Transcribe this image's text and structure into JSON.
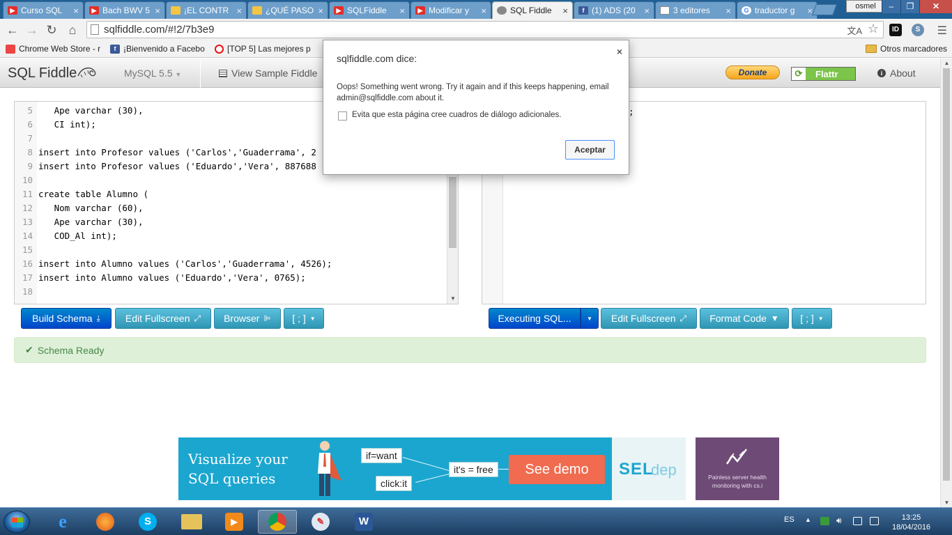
{
  "browser": {
    "tabs": [
      {
        "title": "Curso SQL",
        "icon": "youtube-icon"
      },
      {
        "title": "Bach BWV 5",
        "icon": "youtube-icon"
      },
      {
        "title": "¡EL CONTR",
        "icon": "page-icon"
      },
      {
        "title": "¿QUÉ PASO",
        "icon": "page-icon"
      },
      {
        "title": "SQLFiddle",
        "icon": "youtube-icon"
      },
      {
        "title": "Modificar y",
        "icon": "youtube-icon"
      },
      {
        "title": "SQL Fiddle",
        "icon": "gear-icon",
        "active": true
      },
      {
        "title": "(1) ADS (20",
        "icon": "facebook-icon"
      },
      {
        "title": "3 editores",
        "icon": "doc-icon"
      },
      {
        "title": "traductor g",
        "icon": "google-icon"
      }
    ],
    "tab_close": "×",
    "profile_name": "osmel",
    "window_controls": {
      "minimize": "‒",
      "restore": "❐",
      "close": "✕"
    },
    "url": "sqlfiddle.com/#!2/7b3e9",
    "bookmarks": [
      {
        "label": "Chrome Web Store - r",
        "icon": "webstore-icon"
      },
      {
        "label": "¡Bienvenido a Facebo",
        "icon": "facebook-icon"
      },
      {
        "label": "[TOP 5] Las mejores p",
        "icon": "opera-icon"
      }
    ],
    "other_bookmarks": "Otros marcadores"
  },
  "app": {
    "brand": "SQL Fiddle",
    "db_version": "MySQL 5.5",
    "view_sample": "View Sample Fiddle",
    "donate": "Donate",
    "flattr": "Flattr",
    "about": "About"
  },
  "schema_editor": {
    "lines": [
      {
        "n": "5",
        "text": "   Ape varchar (30),"
      },
      {
        "n": "6",
        "text": "   CI int);"
      },
      {
        "n": "7",
        "text": ""
      },
      {
        "n": "8",
        "text": "insert into Profesor values ('Carlos','Guaderrama', 2"
      },
      {
        "n": "9",
        "text": "insert into Profesor values ('Eduardo','Vera', 887688"
      },
      {
        "n": "10",
        "text": ""
      },
      {
        "n": "11",
        "text": "create table Alumno ("
      },
      {
        "n": "12",
        "text": "   Nom varchar (60),"
      },
      {
        "n": "13",
        "text": "   Ape varchar (30),"
      },
      {
        "n": "14",
        "text": "   COD_Al int);"
      },
      {
        "n": "15",
        "text": ""
      },
      {
        "n": "16",
        "text": "insert into Alumno values ('Carlos','Guaderrama', 4526);"
      },
      {
        "n": "17",
        "text": "insert into Alumno values ('Eduardo','Vera', 0765);"
      },
      {
        "n": "18",
        "text": ""
      }
    ]
  },
  "query_editor": {
    "visible_text": ";"
  },
  "buttons": {
    "build_schema": "Build Schema",
    "edit_fullscreen_left": "Edit Fullscreen",
    "browser": "Browser",
    "terminator_left": "[ ; ]",
    "executing_sql": "Executing SQL...",
    "edit_fullscreen_right": "Edit Fullscreen",
    "format_code": "Format Code",
    "terminator_right": "[ ; ]"
  },
  "status": {
    "message": "Schema Ready"
  },
  "ads": {
    "headline_line1": "Visualize your",
    "headline_line2": "SQL queries",
    "chip_if": "if=want",
    "chip_click": "click:it",
    "chip_free": "it's = free",
    "cta": "See demo",
    "logo_sel": "SEL",
    "logo_dep": "dep",
    "side_text_line1": "Painless server health",
    "side_text_line2": "monitoring with cs.i"
  },
  "dialog": {
    "title": "sqlfiddle.com dice:",
    "close": "×",
    "message": "Oops! Something went wrong. Try it again and if this keeps happening, email admin@sqlfiddle.com about it.",
    "checkbox_label": "Evita que esta página cree cuadros de diálogo adicionales.",
    "ok": "Aceptar"
  },
  "taskbar": {
    "language": "ES",
    "time": "13:25",
    "date": "18/04/2016"
  }
}
